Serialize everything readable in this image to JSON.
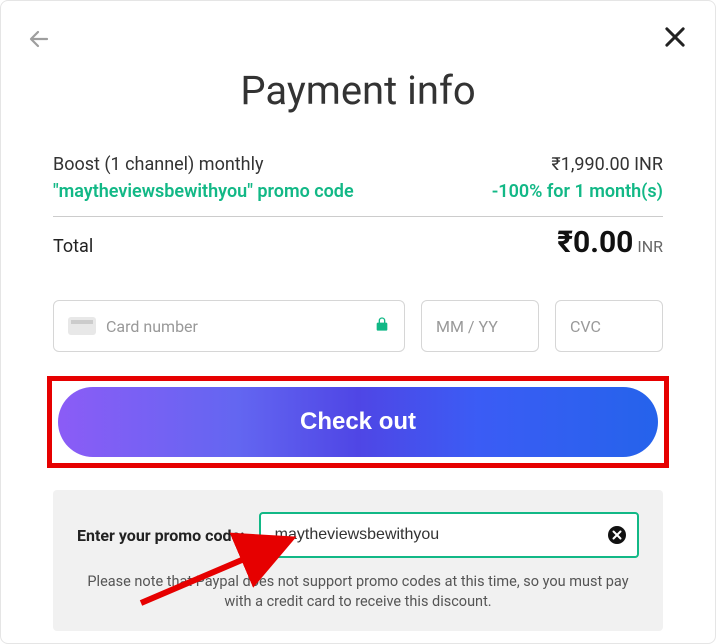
{
  "header": {
    "title": "Payment info"
  },
  "summary": {
    "plan_label": "Boost (1 channel) monthly",
    "plan_price": "₹1,990.00 INR",
    "promo_label_prefix": "\"",
    "promo_code_name": "maytheviewsbewithyou",
    "promo_label_suffix": "\" promo code",
    "promo_discount": "-100% for 1 month(s)",
    "total_label": "Total",
    "total_amount": "₹0.00",
    "total_currency": "INR"
  },
  "card_form": {
    "card_number_placeholder": "Card number",
    "expiry_placeholder": "MM / YY",
    "cvc_placeholder": "CVC"
  },
  "checkout": {
    "label": "Check out"
  },
  "promo_panel": {
    "label": "Enter your promo code:",
    "input_value": "maytheviewsbewithyou",
    "note": "Please note that Paypal does not support promo codes at this time, so you must pay with a credit card to receive this discount."
  }
}
